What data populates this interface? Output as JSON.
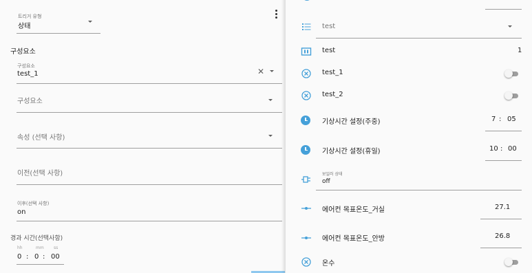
{
  "left": {
    "trigger_type_label": "트리거 유형",
    "trigger_type_value": "상태",
    "section_title": "구성요소",
    "component1_label": "구성요소",
    "component1_value": "test_1",
    "component2_placeholder": "구성요소",
    "attribute_placeholder": "속성 (선택 사항)",
    "from_placeholder": "이전(선택 사항)",
    "to_label": "이후(선택 사항)",
    "to_value": "on",
    "duration_label": "경과 시간(선택사항)",
    "time_hh_label": "hh",
    "time_mm_label": "mm",
    "time_ss_label": "ss",
    "time_hh": "0",
    "time_mm": "0",
    "time_ss": "00",
    "time_sep1": ":",
    "time_sep2": ":"
  },
  "right": {
    "select_value": "test",
    "counter_label": "test",
    "counter_value": "1",
    "switch1_label": "test_1",
    "switch2_label": "test_2",
    "wake_weekday_label": "기상시간 설정(주중)",
    "wake_weekday_hour": "7",
    "wake_weekday_min": "05",
    "wake_holiday_label": "기상시간 설정(휴일)",
    "wake_holiday_hour": "10",
    "wake_holiday_min": "00",
    "time_sep": ":",
    "boolean_label": "보일러 상태",
    "boolean_value": "off",
    "ac_living_label": "에어컨 목표온도_거실",
    "ac_living_value": "27.1",
    "ac_room_label": "에어컨 목표온도_안방",
    "ac_room_value": "26.8",
    "hot_water_label": "온수"
  },
  "colors": {
    "accent_blue": "#45a0d9",
    "toggle_off": "#9e9e9e"
  },
  "icons": [
    "list-icon",
    "counter-icon",
    "close-circle-icon",
    "clock-icon",
    "boolean-icon",
    "slider-icon",
    "kebab-menu-icon",
    "dropdown-arrow-icon",
    "clear-icon"
  ]
}
